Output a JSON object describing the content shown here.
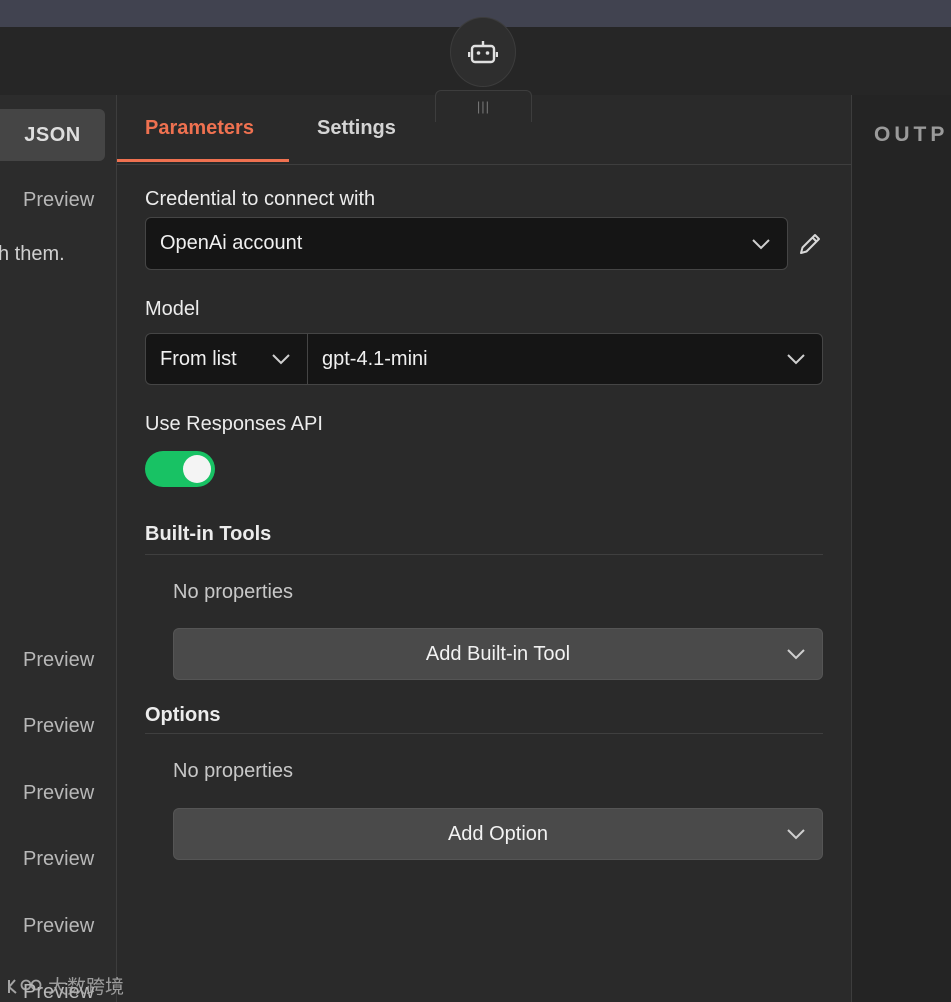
{
  "node_icon": "robot-icon",
  "drag_handle": "|||",
  "left_panel": {
    "json_button": "JSON",
    "preview_top": "Preview",
    "partial_text": "h them.",
    "previews": [
      "Preview",
      "Preview",
      "Preview",
      "Preview",
      "Preview",
      "Preview"
    ]
  },
  "tabs": {
    "parameters": "Parameters",
    "settings": "Settings"
  },
  "credential": {
    "label": "Credential to connect with",
    "value": "OpenAi account"
  },
  "model": {
    "label": "Model",
    "mode": "From list",
    "value": "gpt-4.1-mini"
  },
  "responses_api": {
    "label": "Use Responses API",
    "enabled": true
  },
  "builtin_tools": {
    "title": "Built-in Tools",
    "empty": "No properties",
    "add_label": "Add Built-in Tool"
  },
  "options": {
    "title": "Options",
    "empty": "No properties",
    "add_label": "Add Option"
  },
  "right_panel": {
    "title": "OUTP"
  },
  "watermark": "大数跨境",
  "colors": {
    "accent": "#ef7150",
    "toggle_on": "#18c264"
  }
}
